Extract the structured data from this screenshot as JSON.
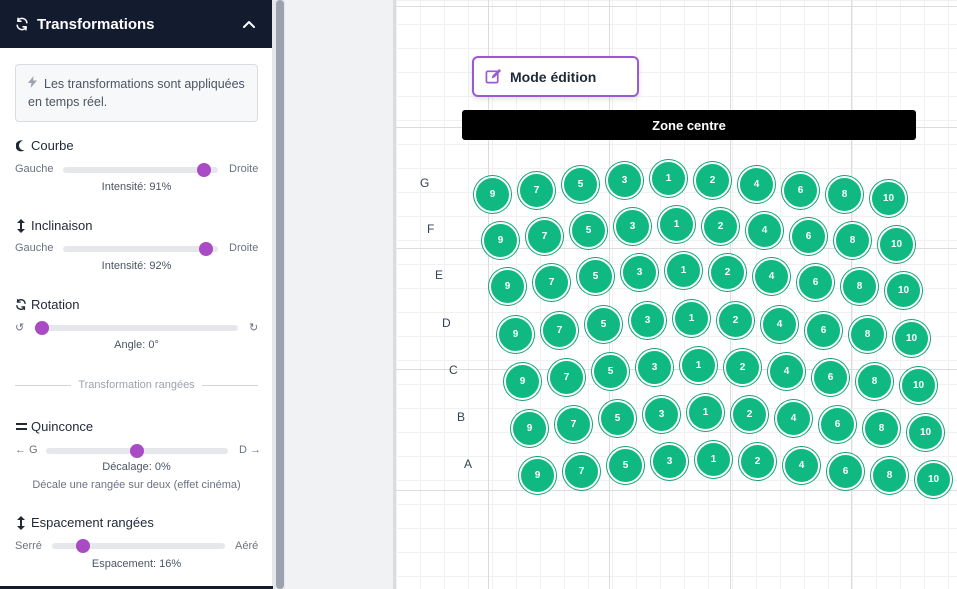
{
  "sidebar": {
    "title": "Transformations",
    "info": "Les transformations sont appliquées en temps réel.",
    "courbe": {
      "title": "Courbe",
      "left": "Gauche",
      "right": "Droite",
      "value_text": "Intensité: 91%",
      "value": 0.91
    },
    "inclinaison": {
      "title": "Inclinaison",
      "left": "Gauche",
      "right": "Droite",
      "value_text": "Intensité: 92%",
      "value": 0.92
    },
    "rotation": {
      "title": "Rotation",
      "left": "↺",
      "right": "↻",
      "value_text": "Angle: 0°",
      "value": 0
    },
    "divider": "Transformation rangées",
    "quinconce": {
      "title": "Quinconce",
      "left": "← G",
      "right": "D →",
      "value_text": "Décalage: 0%",
      "hint": "Décale une rangée sur deux (effet cinéma)",
      "value": 0.5
    },
    "espacement": {
      "title": "Espacement rangées",
      "left": "Serré",
      "right": "Aéré",
      "value_text": "Espacement: 16%",
      "value": 0.18
    }
  },
  "canvas": {
    "mode_label": "Mode édition",
    "zone_label": "Zone centre",
    "rows": [
      {
        "label": "G",
        "seats": [
          "9",
          "7",
          "5",
          "3",
          "1",
          "2",
          "4",
          "6",
          "8",
          "10"
        ]
      },
      {
        "label": "F",
        "seats": [
          "9",
          "7",
          "5",
          "3",
          "1",
          "2",
          "4",
          "6",
          "8",
          "10"
        ]
      },
      {
        "label": "E",
        "seats": [
          "9",
          "7",
          "5",
          "3",
          "1",
          "2",
          "4",
          "6",
          "8",
          "10"
        ]
      },
      {
        "label": "D",
        "seats": [
          "9",
          "7",
          "5",
          "3",
          "1",
          "2",
          "4",
          "6",
          "8",
          "10"
        ]
      },
      {
        "label": "C",
        "seats": [
          "9",
          "7",
          "5",
          "3",
          "1",
          "2",
          "4",
          "6",
          "8",
          "10"
        ]
      },
      {
        "label": "B",
        "seats": [
          "9",
          "7",
          "5",
          "3",
          "1",
          "2",
          "4",
          "6",
          "8",
          "10"
        ]
      },
      {
        "label": "A",
        "seats": [
          "9",
          "7",
          "5",
          "3",
          "1",
          "2",
          "4",
          "6",
          "8",
          "10"
        ]
      }
    ]
  },
  "colors": {
    "seat": "#10b981",
    "accent": "#a84bc4",
    "header": "#131b2e",
    "edit_border": "#9b59d6"
  }
}
